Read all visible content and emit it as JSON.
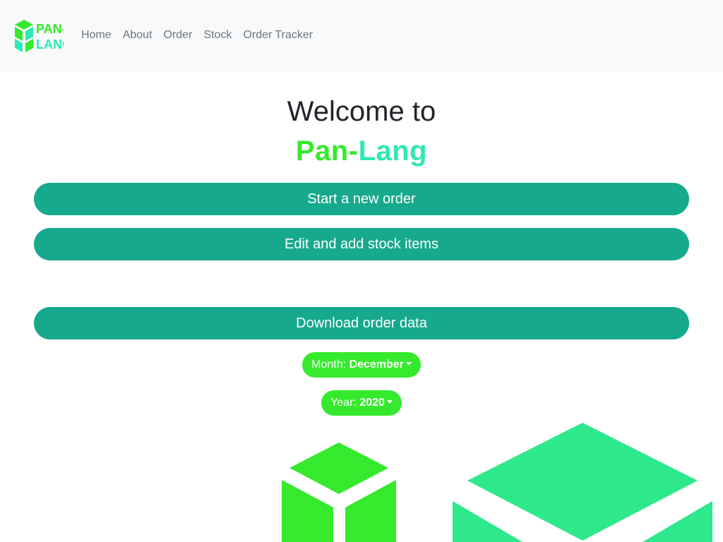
{
  "colors": {
    "navbar_bg": "#f8f9fa",
    "nav_link": "#6c757d",
    "primary_button": "#17a98c",
    "pill_button": "#35ea2c",
    "brand_green": "#35ea2c",
    "brand_teal": "#2ee8b5",
    "deco_cube_green": "#35ea2c",
    "deco_cube_teal": "#2ee88c"
  },
  "navbar": {
    "logo": {
      "icon": "cube-logo-icon",
      "line1": "PAN-",
      "line2": "LANG"
    },
    "links": [
      "Home",
      "About",
      "Order",
      "Stock",
      "Order Tracker"
    ]
  },
  "hero": {
    "title": "Welcome to",
    "brand_part1": "Pan-",
    "brand_part2": "Lang"
  },
  "actions": {
    "new_order": "Start a new order",
    "edit_stock": "Edit and add stock items",
    "download": "Download order data"
  },
  "filters": {
    "month_label": "Month:",
    "month_value": "December",
    "year_label": "Year:",
    "year_value": "2020"
  }
}
